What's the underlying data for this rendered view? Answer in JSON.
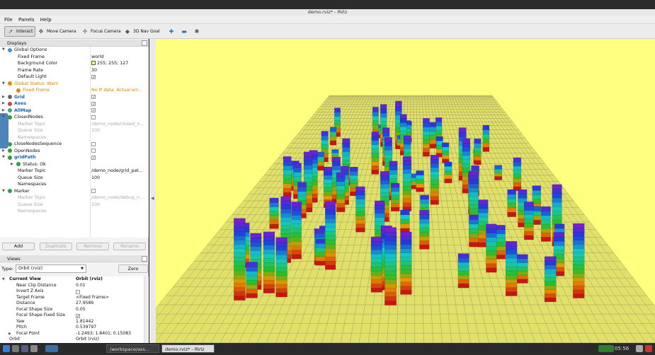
{
  "window": {
    "title": "demo.rviz* - RViz"
  },
  "menu": [
    "File",
    "Panels",
    "Help"
  ],
  "toolbar": {
    "tools": [
      {
        "label": "Interact",
        "icon": "cursor-icon",
        "active": true
      },
      {
        "label": "Move Camera",
        "icon": "move-camera-icon",
        "active": false
      },
      {
        "label": "Focus Camera",
        "icon": "focus-camera-icon",
        "active": false
      },
      {
        "label": "3D Nav Goal",
        "icon": "nav-goal-icon",
        "active": false
      }
    ]
  },
  "displays": {
    "header": "Displays",
    "rows": [
      {
        "label": "Global Options",
        "value": "",
        "indent": 0,
        "expand": "down",
        "icon": "globe-icon",
        "style": ""
      },
      {
        "label": "Fixed Frame",
        "value": "world",
        "indent": 1,
        "style": ""
      },
      {
        "label": "Background Color",
        "value": "255; 255; 127",
        "indent": 1,
        "swatch": "#ffff7f",
        "style": ""
      },
      {
        "label": "Frame Rate",
        "value": "30",
        "indent": 1,
        "style": ""
      },
      {
        "label": "Default Light",
        "value": "✓",
        "indent": 1,
        "check": true,
        "style": ""
      },
      {
        "label": "Global Status: Warn",
        "value": "",
        "indent": 0,
        "expand": "down",
        "icon": "warning-icon",
        "style": "warn"
      },
      {
        "label": "Fixed Frame",
        "value": "No tf data.  Actual err...",
        "indent": 1,
        "icon": "warning-icon",
        "style": "warn"
      },
      {
        "label": "Grid",
        "value": "✓",
        "indent": 0,
        "expand": "right",
        "icon": "grid-icon",
        "check": true,
        "style": "blue"
      },
      {
        "label": "Axes",
        "value": "✓",
        "indent": 0,
        "expand": "right",
        "icon": "axes-icon",
        "check": true,
        "style": "blue"
      },
      {
        "label": "AllMap",
        "value": "✓",
        "indent": 0,
        "expand": "right",
        "icon": "map-icon",
        "check": true,
        "style": "blue"
      },
      {
        "label": "ClosedNodes",
        "value": "",
        "indent": 0,
        "expand": "down",
        "icon": "marker-icon",
        "check": true,
        "style": ""
      },
      {
        "label": "Marker Topic",
        "value": "/demo_node/closed_n...",
        "indent": 1,
        "style": "dis"
      },
      {
        "label": "Queue Size",
        "value": "100",
        "indent": 1,
        "style": "dis"
      },
      {
        "label": "Namespaces",
        "value": "",
        "indent": 1,
        "style": "dis"
      },
      {
        "label": "closeNodesSequence",
        "value": "",
        "indent": 0,
        "icon": "marker-icon",
        "check": true,
        "style": ""
      },
      {
        "label": "OpenNodes",
        "value": "",
        "indent": 0,
        "expand": "right",
        "icon": "marker-icon",
        "check": true,
        "style": ""
      },
      {
        "label": "gridPath",
        "value": "✓",
        "indent": 0,
        "expand": "down",
        "icon": "marker-icon",
        "check": true,
        "style": "blue"
      },
      {
        "label": "Status: Ok",
        "value": "",
        "indent": 1,
        "expand": "right",
        "icon": "ok-icon",
        "style": ""
      },
      {
        "label": "Marker Topic",
        "value": "/demo_node/grid_pat...",
        "indent": 1,
        "style": ""
      },
      {
        "label": "Queue Size",
        "value": "100",
        "indent": 1,
        "style": ""
      },
      {
        "label": "Namespaces",
        "value": "",
        "indent": 1,
        "style": ""
      },
      {
        "label": "Marker",
        "value": "",
        "indent": 0,
        "expand": "down",
        "icon": "marker-icon",
        "check": true,
        "style": ""
      },
      {
        "label": "Marker Topic",
        "value": "/demo_node/debug_n...",
        "indent": 1,
        "style": "dis"
      },
      {
        "label": "Queue Size",
        "value": "100",
        "indent": 1,
        "style": "dis"
      },
      {
        "label": "Namespaces",
        "value": "",
        "indent": 1,
        "style": "dis"
      }
    ],
    "buttons": [
      {
        "label": "Add",
        "enabled": true
      },
      {
        "label": "Duplicate",
        "enabled": false
      },
      {
        "label": "Remove",
        "enabled": false
      },
      {
        "label": "Rename",
        "enabled": false
      }
    ]
  },
  "views": {
    "header": "Views",
    "type_label": "Type:",
    "type_value": "Orbit (rviz)",
    "zero_label": "Zero",
    "rows": [
      {
        "label": "Current View",
        "value": "Orbit (rviz)",
        "bold": true,
        "indent": 0,
        "expand": "down"
      },
      {
        "label": "Near Clip Distance",
        "value": "0.01",
        "indent": 1
      },
      {
        "label": "Invert Z Axis",
        "value": "",
        "indent": 1,
        "check": true
      },
      {
        "label": "Target Frame",
        "value": "<Fixed Frame>",
        "indent": 1
      },
      {
        "label": "Distance",
        "value": "27.9586",
        "indent": 1
      },
      {
        "label": "Focal Shape Size",
        "value": "0.05",
        "indent": 1
      },
      {
        "label": "Focal Shape Fixed Size",
        "value": "✓",
        "indent": 1,
        "check": true
      },
      {
        "label": "Yaw",
        "value": "1.81442",
        "indent": 1
      },
      {
        "label": "Pitch",
        "value": "0.539797",
        "indent": 1
      },
      {
        "label": "Focal Point",
        "value": "-1.2493; 1.8401; 0.15083",
        "indent": 1,
        "expand": "right"
      },
      {
        "label": "Orbit",
        "value": "Orbit (rviz)",
        "indent": 0
      }
    ]
  },
  "taskbar": {
    "tasks": [
      {
        "label": "/workspace/ass...",
        "active": false
      },
      {
        "label": "demo.rviz* - RViz",
        "active": true
      }
    ],
    "clock": "05:56"
  },
  "colors": {
    "background": "#ffff7f",
    "grid": "#a0a060",
    "accent": "#2f6fb0"
  }
}
